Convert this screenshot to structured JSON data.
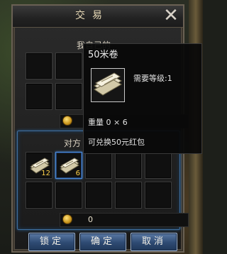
{
  "window": {
    "title": "交易",
    "close_label": "✕",
    "my_section_label": "我自己的",
    "other_section_label": "对方",
    "my_money": "0",
    "other_money": "0"
  },
  "items": {
    "other_slot_1_count": "12",
    "other_slot_2_count": "6"
  },
  "tooltip": {
    "name": "50米卷",
    "level_req": "需要等级:1",
    "weight": "重量 0 × 6",
    "desc": "可兑换50元红包"
  },
  "buttons": {
    "lock": "锁定",
    "confirm": "确定",
    "cancel": "取消"
  },
  "colors": {
    "highlight_border": "#4a8ad8",
    "stack_count": "#ffd24a",
    "button_fill": "#2e4a72"
  }
}
